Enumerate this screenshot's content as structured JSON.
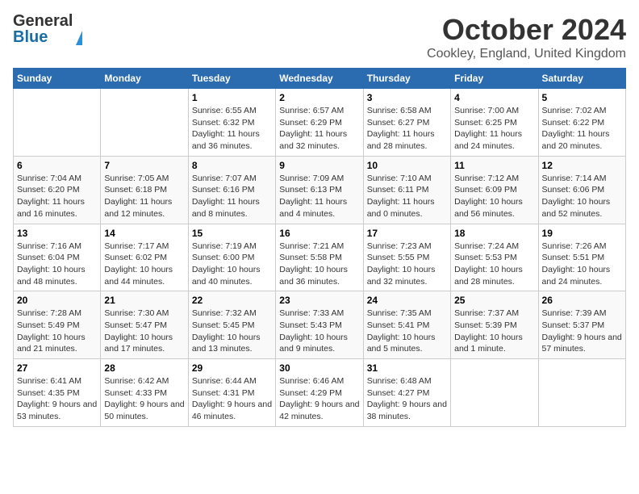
{
  "logo": {
    "general": "General",
    "blue": "Blue"
  },
  "title": "October 2024",
  "location": "Cookley, England, United Kingdom",
  "days_of_week": [
    "Sunday",
    "Monday",
    "Tuesday",
    "Wednesday",
    "Thursday",
    "Friday",
    "Saturday"
  ],
  "weeks": [
    [
      {
        "day": "",
        "sunrise": "",
        "sunset": "",
        "daylight": ""
      },
      {
        "day": "",
        "sunrise": "",
        "sunset": "",
        "daylight": ""
      },
      {
        "day": "1",
        "sunrise": "Sunrise: 6:55 AM",
        "sunset": "Sunset: 6:32 PM",
        "daylight": "Daylight: 11 hours and 36 minutes."
      },
      {
        "day": "2",
        "sunrise": "Sunrise: 6:57 AM",
        "sunset": "Sunset: 6:29 PM",
        "daylight": "Daylight: 11 hours and 32 minutes."
      },
      {
        "day": "3",
        "sunrise": "Sunrise: 6:58 AM",
        "sunset": "Sunset: 6:27 PM",
        "daylight": "Daylight: 11 hours and 28 minutes."
      },
      {
        "day": "4",
        "sunrise": "Sunrise: 7:00 AM",
        "sunset": "Sunset: 6:25 PM",
        "daylight": "Daylight: 11 hours and 24 minutes."
      },
      {
        "day": "5",
        "sunrise": "Sunrise: 7:02 AM",
        "sunset": "Sunset: 6:22 PM",
        "daylight": "Daylight: 11 hours and 20 minutes."
      }
    ],
    [
      {
        "day": "6",
        "sunrise": "Sunrise: 7:04 AM",
        "sunset": "Sunset: 6:20 PM",
        "daylight": "Daylight: 11 hours and 16 minutes."
      },
      {
        "day": "7",
        "sunrise": "Sunrise: 7:05 AM",
        "sunset": "Sunset: 6:18 PM",
        "daylight": "Daylight: 11 hours and 12 minutes."
      },
      {
        "day": "8",
        "sunrise": "Sunrise: 7:07 AM",
        "sunset": "Sunset: 6:16 PM",
        "daylight": "Daylight: 11 hours and 8 minutes."
      },
      {
        "day": "9",
        "sunrise": "Sunrise: 7:09 AM",
        "sunset": "Sunset: 6:13 PM",
        "daylight": "Daylight: 11 hours and 4 minutes."
      },
      {
        "day": "10",
        "sunrise": "Sunrise: 7:10 AM",
        "sunset": "Sunset: 6:11 PM",
        "daylight": "Daylight: 11 hours and 0 minutes."
      },
      {
        "day": "11",
        "sunrise": "Sunrise: 7:12 AM",
        "sunset": "Sunset: 6:09 PM",
        "daylight": "Daylight: 10 hours and 56 minutes."
      },
      {
        "day": "12",
        "sunrise": "Sunrise: 7:14 AM",
        "sunset": "Sunset: 6:06 PM",
        "daylight": "Daylight: 10 hours and 52 minutes."
      }
    ],
    [
      {
        "day": "13",
        "sunrise": "Sunrise: 7:16 AM",
        "sunset": "Sunset: 6:04 PM",
        "daylight": "Daylight: 10 hours and 48 minutes."
      },
      {
        "day": "14",
        "sunrise": "Sunrise: 7:17 AM",
        "sunset": "Sunset: 6:02 PM",
        "daylight": "Daylight: 10 hours and 44 minutes."
      },
      {
        "day": "15",
        "sunrise": "Sunrise: 7:19 AM",
        "sunset": "Sunset: 6:00 PM",
        "daylight": "Daylight: 10 hours and 40 minutes."
      },
      {
        "day": "16",
        "sunrise": "Sunrise: 7:21 AM",
        "sunset": "Sunset: 5:58 PM",
        "daylight": "Daylight: 10 hours and 36 minutes."
      },
      {
        "day": "17",
        "sunrise": "Sunrise: 7:23 AM",
        "sunset": "Sunset: 5:55 PM",
        "daylight": "Daylight: 10 hours and 32 minutes."
      },
      {
        "day": "18",
        "sunrise": "Sunrise: 7:24 AM",
        "sunset": "Sunset: 5:53 PM",
        "daylight": "Daylight: 10 hours and 28 minutes."
      },
      {
        "day": "19",
        "sunrise": "Sunrise: 7:26 AM",
        "sunset": "Sunset: 5:51 PM",
        "daylight": "Daylight: 10 hours and 24 minutes."
      }
    ],
    [
      {
        "day": "20",
        "sunrise": "Sunrise: 7:28 AM",
        "sunset": "Sunset: 5:49 PM",
        "daylight": "Daylight: 10 hours and 21 minutes."
      },
      {
        "day": "21",
        "sunrise": "Sunrise: 7:30 AM",
        "sunset": "Sunset: 5:47 PM",
        "daylight": "Daylight: 10 hours and 17 minutes."
      },
      {
        "day": "22",
        "sunrise": "Sunrise: 7:32 AM",
        "sunset": "Sunset: 5:45 PM",
        "daylight": "Daylight: 10 hours and 13 minutes."
      },
      {
        "day": "23",
        "sunrise": "Sunrise: 7:33 AM",
        "sunset": "Sunset: 5:43 PM",
        "daylight": "Daylight: 10 hours and 9 minutes."
      },
      {
        "day": "24",
        "sunrise": "Sunrise: 7:35 AM",
        "sunset": "Sunset: 5:41 PM",
        "daylight": "Daylight: 10 hours and 5 minutes."
      },
      {
        "day": "25",
        "sunrise": "Sunrise: 7:37 AM",
        "sunset": "Sunset: 5:39 PM",
        "daylight": "Daylight: 10 hours and 1 minute."
      },
      {
        "day": "26",
        "sunrise": "Sunrise: 7:39 AM",
        "sunset": "Sunset: 5:37 PM",
        "daylight": "Daylight: 9 hours and 57 minutes."
      }
    ],
    [
      {
        "day": "27",
        "sunrise": "Sunrise: 6:41 AM",
        "sunset": "Sunset: 4:35 PM",
        "daylight": "Daylight: 9 hours and 53 minutes."
      },
      {
        "day": "28",
        "sunrise": "Sunrise: 6:42 AM",
        "sunset": "Sunset: 4:33 PM",
        "daylight": "Daylight: 9 hours and 50 minutes."
      },
      {
        "day": "29",
        "sunrise": "Sunrise: 6:44 AM",
        "sunset": "Sunset: 4:31 PM",
        "daylight": "Daylight: 9 hours and 46 minutes."
      },
      {
        "day": "30",
        "sunrise": "Sunrise: 6:46 AM",
        "sunset": "Sunset: 4:29 PM",
        "daylight": "Daylight: 9 hours and 42 minutes."
      },
      {
        "day": "31",
        "sunrise": "Sunrise: 6:48 AM",
        "sunset": "Sunset: 4:27 PM",
        "daylight": "Daylight: 9 hours and 38 minutes."
      },
      {
        "day": "",
        "sunrise": "",
        "sunset": "",
        "daylight": ""
      },
      {
        "day": "",
        "sunrise": "",
        "sunset": "",
        "daylight": ""
      }
    ]
  ]
}
